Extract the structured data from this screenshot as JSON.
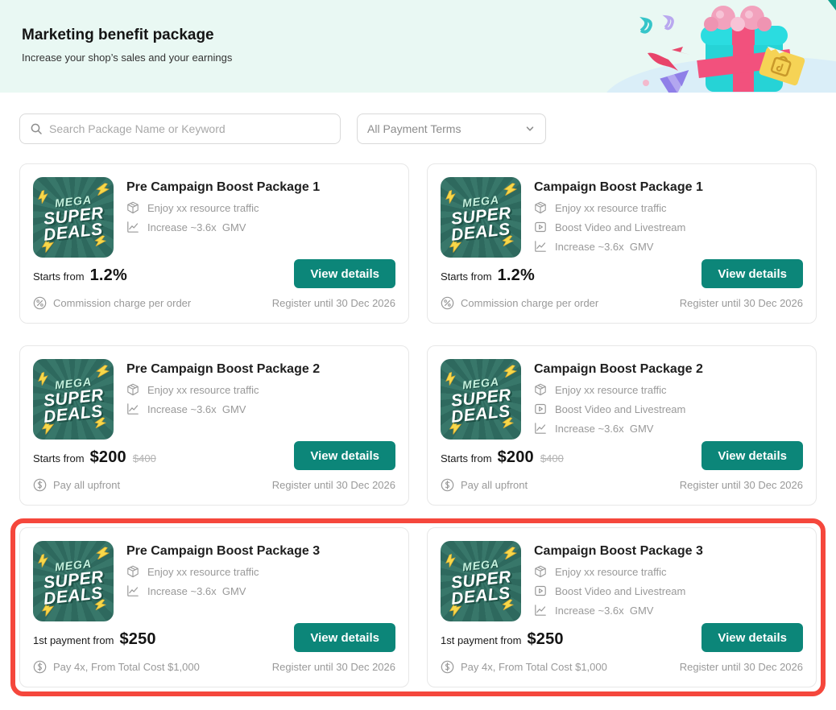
{
  "header": {
    "title": "Marketing benefit package",
    "subtitle": "Increase your shop’s sales and your earnings"
  },
  "filters": {
    "search_placeholder": "Search Package Name or Keyword",
    "payment_terms_value": "All Payment Terms"
  },
  "badge": {
    "line1": "MEGA",
    "line2": "SUPER",
    "line3": "DEALS"
  },
  "buttons": {
    "view_details": "View details"
  },
  "cards": [
    {
      "title": "Pre Campaign Boost Package 1",
      "features": [
        {
          "icon": "package-icon",
          "text": "Enjoy xx resource traffic"
        },
        {
          "icon": "chart-icon",
          "text": "Increase ~3.6x  GMV"
        }
      ],
      "price_label": "Starts from",
      "price": "1.2%",
      "old_price": "",
      "payment_icon": "percent-circle-icon",
      "payment_note": "Commission charge per order",
      "register_until": "Register until 30 Dec 2026",
      "highlighted": false
    },
    {
      "title": "Campaign Boost Package 1",
      "features": [
        {
          "icon": "package-icon",
          "text": "Enjoy xx resource traffic"
        },
        {
          "icon": "video-icon",
          "text": "Boost Video and Livestream"
        },
        {
          "icon": "chart-icon",
          "text": "Increase ~3.6x  GMV"
        }
      ],
      "price_label": "Starts from",
      "price": "1.2%",
      "old_price": "",
      "payment_icon": "percent-circle-icon",
      "payment_note": "Commission charge per order",
      "register_until": "Register until 30 Dec 2026",
      "highlighted": false
    },
    {
      "title": "Pre Campaign Boost Package 2",
      "features": [
        {
          "icon": "package-icon",
          "text": "Enjoy xx resource traffic"
        },
        {
          "icon": "chart-icon",
          "text": "Increase ~3.6x  GMV"
        }
      ],
      "price_label": "Starts from",
      "price": "$200",
      "old_price": "$400",
      "payment_icon": "dollar-circle-icon",
      "payment_note": "Pay all upfront",
      "register_until": "Register until 30 Dec 2026",
      "highlighted": false
    },
    {
      "title": "Campaign Boost Package 2",
      "features": [
        {
          "icon": "package-icon",
          "text": "Enjoy xx resource traffic"
        },
        {
          "icon": "video-icon",
          "text": "Boost Video and Livestream"
        },
        {
          "icon": "chart-icon",
          "text": "Increase ~3.6x  GMV"
        }
      ],
      "price_label": "Starts from",
      "price": "$200",
      "old_price": "$400",
      "payment_icon": "dollar-circle-icon",
      "payment_note": "Pay all upfront",
      "register_until": "Register until 30 Dec 2026",
      "highlighted": false
    },
    {
      "title": "Pre Campaign Boost Package 3",
      "features": [
        {
          "icon": "package-icon",
          "text": "Enjoy xx resource traffic"
        },
        {
          "icon": "chart-icon",
          "text": "Increase ~3.6x  GMV"
        }
      ],
      "price_label": "1st payment from",
      "price": "$250",
      "old_price": "",
      "payment_icon": "dollar-circle-icon",
      "payment_note": "Pay 4x, From Total Cost $1,000",
      "register_until": "Register until 30 Dec 2026",
      "highlighted": true
    },
    {
      "title": "Campaign Boost Package 3",
      "features": [
        {
          "icon": "package-icon",
          "text": "Enjoy xx resource traffic"
        },
        {
          "icon": "video-icon",
          "text": "Boost Video and Livestream"
        },
        {
          "icon": "chart-icon",
          "text": "Increase ~3.6x  GMV"
        }
      ],
      "price_label": "1st payment from",
      "price": "$250",
      "old_price": "",
      "payment_icon": "dollar-circle-icon",
      "payment_note": "Pay 4x, From Total Cost $1,000",
      "register_until": "Register until 30 Dec 2026",
      "highlighted": true
    }
  ],
  "colors": {
    "accent": "#0c8679",
    "highlight": "#f5473c",
    "header-bg": "#e9f8f3",
    "badge-bg": "#337063"
  }
}
